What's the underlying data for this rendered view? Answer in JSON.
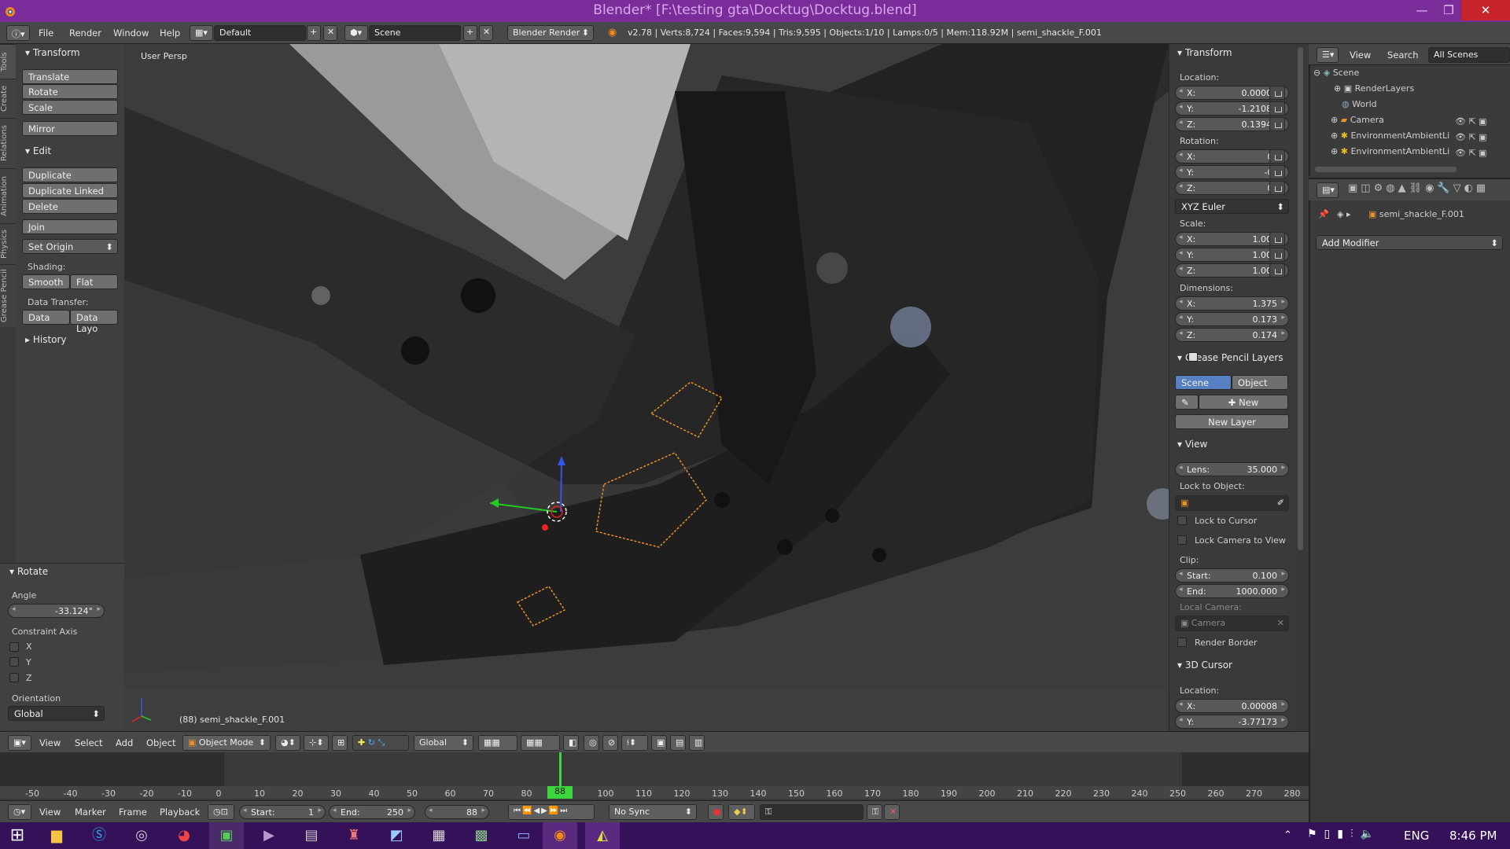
{
  "window": {
    "title": "Blender* [F:\\testing gta\\Docktug\\Docktug.blend]",
    "minimize": "—",
    "maximize": "❐",
    "close": "✕"
  },
  "header": {
    "menu": [
      "File",
      "Render",
      "Window",
      "Help"
    ],
    "layout": "Default",
    "scene": "Scene",
    "engine": "Blender Render",
    "stats": "v2.78 | Verts:8,724 | Faces:9,594 | Tris:9,595 | Objects:1/10 | Lamps:0/5 | Mem:118.92M | semi_shackle_F.001"
  },
  "left_tabs": [
    "Tools",
    "Create",
    "Relations",
    "Animation",
    "Physics",
    "Grease Pencil"
  ],
  "tools": {
    "transform_header": "Transform",
    "translate": "Translate",
    "rotate": "Rotate",
    "scale": "Scale",
    "mirror": "Mirror",
    "edit_header": "Edit",
    "duplicate": "Duplicate",
    "duplicate_linked": "Duplicate Linked",
    "delete": "Delete",
    "join": "Join",
    "set_origin": "Set Origin",
    "shading_label": "Shading:",
    "smooth": "Smooth",
    "flat": "Flat",
    "data_transfer_label": "Data Transfer:",
    "data": "Data",
    "data_layout": "Data Layo",
    "history_header": "History"
  },
  "operator": {
    "header": "Rotate",
    "angle_label": "Angle",
    "angle": "-33.124°",
    "constraint_label": "Constraint Axis",
    "x": "X",
    "y": "Y",
    "z": "Z",
    "orientation_label": "Orientation",
    "orientation": "Global"
  },
  "viewport": {
    "view_name": "User Persp",
    "object_label": "(88) semi_shackle_F.001"
  },
  "properties": {
    "transform_header": "Transform",
    "location_label": "Location:",
    "loc_x": "0.00000",
    "loc_y": "-1.21082",
    "loc_z": "0.13948",
    "rotation_label": "Rotation:",
    "rot_x": "0°",
    "rot_y": "-0°",
    "rot_z": "0°",
    "rotation_mode": "XYZ Euler",
    "scale_label": "Scale:",
    "scale_x": "1.000",
    "scale_y": "1.000",
    "scale_z": "1.000",
    "dimensions_label": "Dimensions:",
    "dim_x": "1.375",
    "dim_y": "0.173",
    "dim_z": "0.174",
    "gp_header": "Grease Pencil Layers",
    "gp_scene": "Scene",
    "gp_object": "Object",
    "gp_new": "New",
    "gp_new_layer": "New Layer",
    "view_header": "View",
    "lens_label": "Lens:",
    "lens": "35.000",
    "lock_object_label": "Lock to Object:",
    "lock_cursor": "Lock to Cursor",
    "lock_camera": "Lock Camera to View",
    "clip_label": "Clip:",
    "clip_start_label": "Start:",
    "clip_start": "0.100",
    "clip_end_label": "End:",
    "clip_end": "1000.000",
    "local_camera_label": "Local Camera:",
    "local_camera": "Camera",
    "render_border": "Render Border",
    "cursor_header": "3D Cursor",
    "cursor_location_label": "Location:",
    "cursor_x": "0.00008",
    "cursor_y": "-3.77173",
    "axis_x": "X:",
    "axis_y": "Y:",
    "axis_z": "Z:"
  },
  "outliner": {
    "view": "View",
    "search": "Search",
    "all_scenes": "All Scenes",
    "items": [
      "Scene",
      "RenderLayers",
      "World",
      "Camera",
      "EnvironmentAmbientLi",
      "EnvironmentAmbientLi"
    ]
  },
  "props_editor": {
    "object_name": "semi_shackle_F.001",
    "add_modifier": "Add Modifier"
  },
  "view3d_header": {
    "menu": [
      "View",
      "Select",
      "Add",
      "Object"
    ],
    "mode": "Object Mode",
    "orientation": "Global"
  },
  "timeline": {
    "ticks": [
      "-50",
      "-40",
      "-30",
      "-20",
      "-10",
      "0",
      "10",
      "20",
      "30",
      "40",
      "50",
      "60",
      "70",
      "80",
      "90",
      "100",
      "110",
      "120",
      "130",
      "140",
      "150",
      "160",
      "170",
      "180",
      "190",
      "200",
      "210",
      "220",
      "230",
      "240",
      "250",
      "260",
      "270",
      "280"
    ],
    "current_frame": 88,
    "menu": [
      "View",
      "Marker",
      "Frame",
      "Playback"
    ],
    "start_label": "Start:",
    "start": "1",
    "end_label": "End:",
    "end": "250",
    "frame": "88",
    "sync": "No Sync"
  },
  "taskbar": {
    "lang": "ENG",
    "time": "8:46 PM"
  },
  "colors": {
    "title_bar": "#7a2d9a",
    "taskbar": "#35115a",
    "selection_orange": "#e8902a",
    "active_blue": "#5680c2"
  }
}
